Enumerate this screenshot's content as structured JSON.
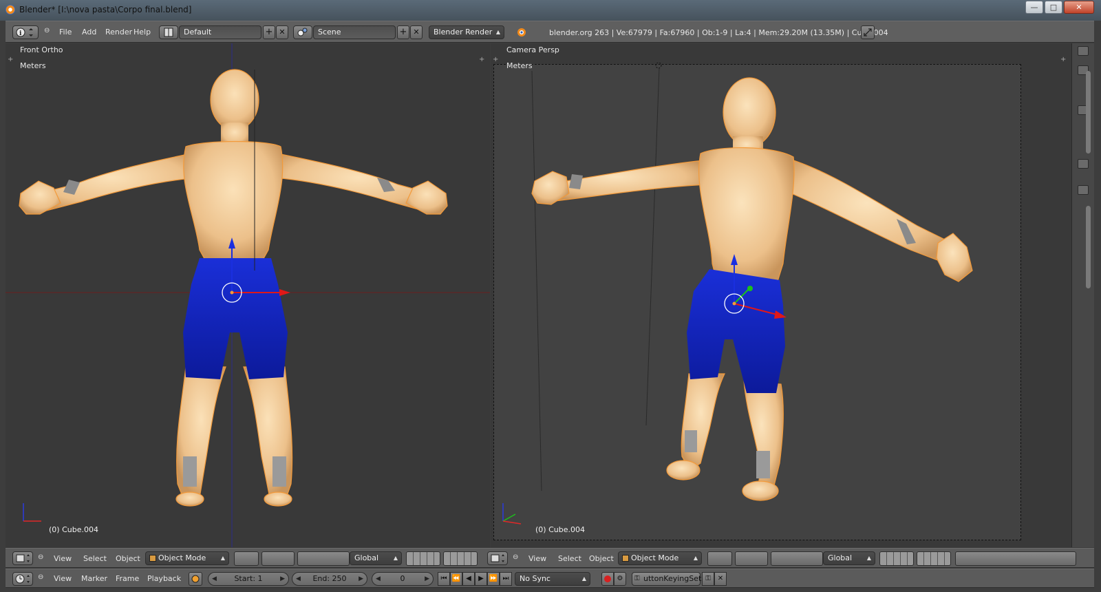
{
  "window": {
    "title": "Blender* [I:\\nova pasta\\Corpo final.blend]",
    "min_label": "—",
    "max_label": "□",
    "close_label": "✕"
  },
  "header": {
    "menus": [
      "File",
      "Add",
      "Render",
      "Help"
    ],
    "layout_value": "Default",
    "scene_value": "Scene",
    "engine_value": "Blender Render",
    "stats": "blender.org 263 | Ve:67979 | Fa:67960 | Ob:1-9 | La:4 | Mem:29.20M (13.35M) | Cube.004",
    "add_glyph": "+",
    "remove_glyph": "✕"
  },
  "left_view": {
    "projection": "Front Ortho",
    "units": "Meters",
    "object_label": "(0) Cube.004"
  },
  "right_view": {
    "projection": "Camera Persp",
    "units": "Meters",
    "object_label": "(0) Cube.004"
  },
  "view3d_header_left": {
    "menus": [
      "View",
      "Select",
      "Object"
    ],
    "mode": "Object Mode",
    "orientation": "Global"
  },
  "view3d_header_right": {
    "menus": [
      "View",
      "Select",
      "Object"
    ],
    "mode": "Object Mode",
    "orientation": "Global"
  },
  "timeline": {
    "menus": [
      "View",
      "Marker",
      "Frame",
      "Playback"
    ],
    "start": "Start: 1",
    "end": "End: 250",
    "current": "0",
    "sync": "No Sync",
    "keying_set": "uttonKeyingSet"
  },
  "colors": {
    "skin": "#f0c896",
    "shorts": "#1222b4",
    "accent_orange": "#f08a1c"
  }
}
